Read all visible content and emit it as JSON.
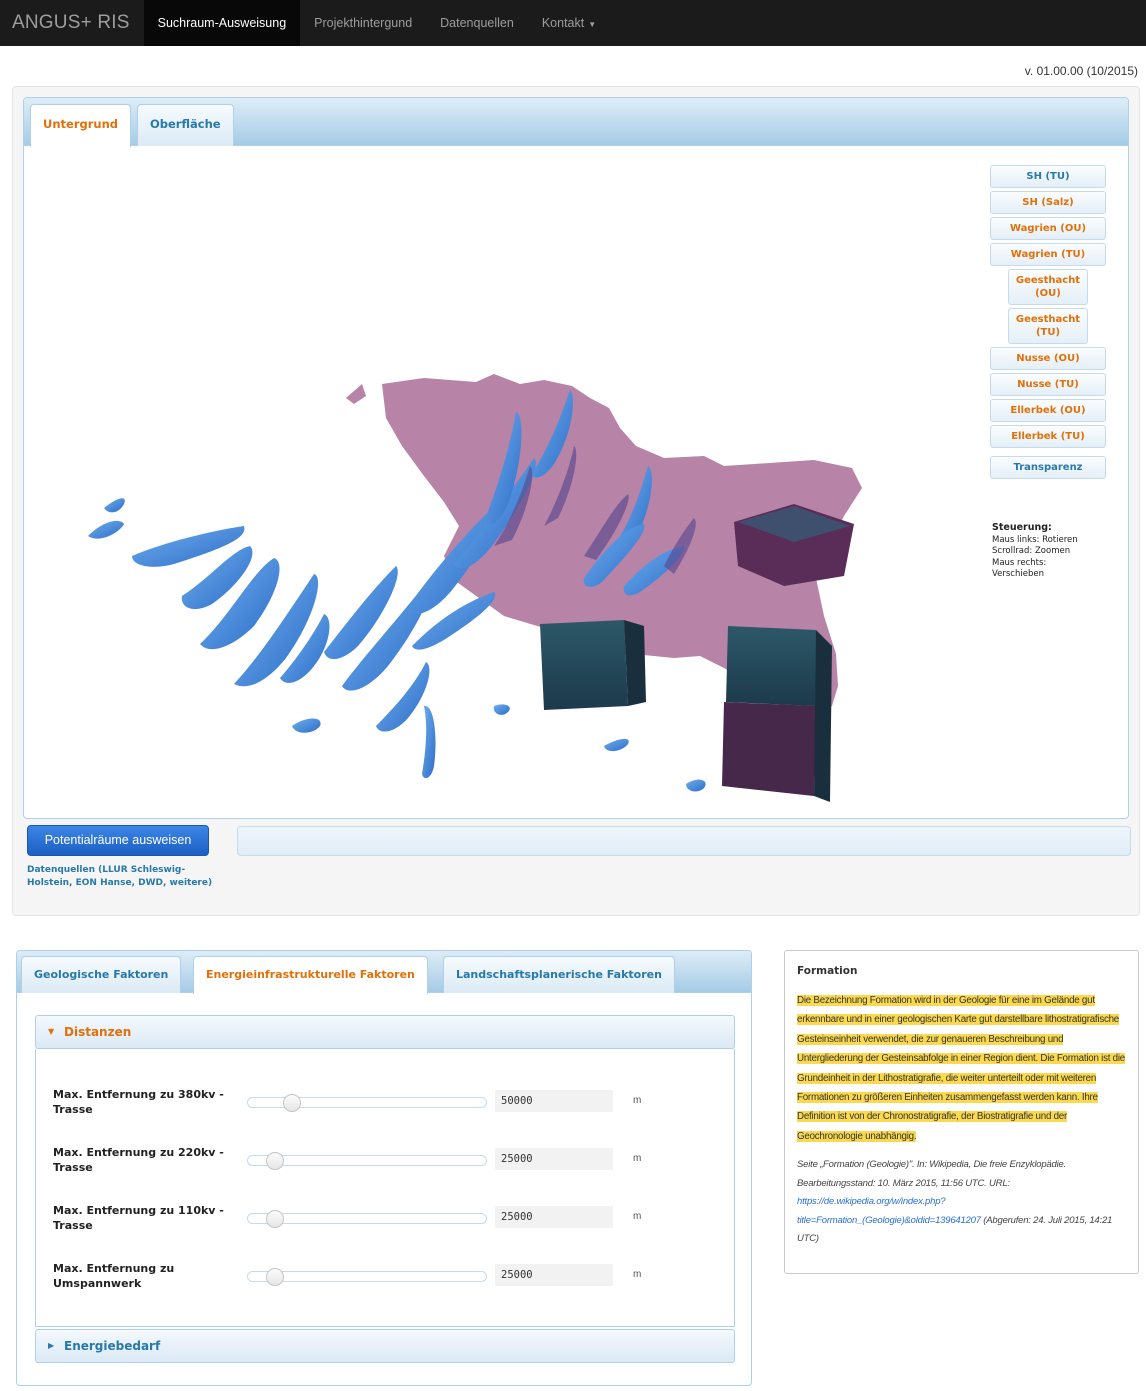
{
  "nav": {
    "brand": "ANGUS+ RIS",
    "items": [
      {
        "label": "Suchraum-Ausweisung",
        "active": true
      },
      {
        "label": "Projekthintergund",
        "active": false
      },
      {
        "label": "Datenquellen",
        "active": false
      },
      {
        "label": "Kontakt",
        "active": false,
        "dropdown": true
      }
    ]
  },
  "version": "v. 01.00.00 (10/2015)",
  "viewer": {
    "tabs": [
      {
        "label": "Untergrund",
        "active": true
      },
      {
        "label": "Oberfläche",
        "active": false
      }
    ],
    "layers": [
      {
        "label": "SH (TU)",
        "color": "blue"
      },
      {
        "label": "SH (Salz)",
        "color": "orange"
      },
      {
        "label": "Wagrien (OU)",
        "color": "orange"
      },
      {
        "label": "Wagrien (TU)",
        "color": "orange"
      },
      {
        "label": "Geesthacht (OU)",
        "color": "orange"
      },
      {
        "label": "Geesthacht (TU)",
        "color": "orange"
      },
      {
        "label": "Nusse (OU)",
        "color": "orange"
      },
      {
        "label": "Nusse (TU)",
        "color": "orange"
      },
      {
        "label": "Ellerbek (OU)",
        "color": "orange"
      },
      {
        "label": "Ellerbek (TU)",
        "color": "orange"
      }
    ],
    "transparency_label": "Transparenz",
    "controls": {
      "title": "Steuerung:",
      "line1": "Maus links: Rotieren",
      "line2": "Scrollrad: Zoomen",
      "line3": "Maus rechts:",
      "line4": "Verschieben"
    },
    "action_button": "Potentialräume ausweisen",
    "sources_link": "Datenquellen (LLUR Schleswig-Holstein, EON Hanse, DWD, weitere)",
    "colors": {
      "terrain": "#b783a6",
      "salt": "#3d7fd4",
      "blocks": "#234a5c"
    }
  },
  "factors": {
    "tabs": [
      {
        "label": "Geologische Faktoren",
        "active": false
      },
      {
        "label": "Energieinfrastrukturelle Faktoren",
        "active": true
      },
      {
        "label": "Landschaftsplanerische Faktoren",
        "active": false
      }
    ],
    "accordion_open": "Distanzen",
    "accordion_closed": "Energiebedarf",
    "rows": [
      {
        "label": "Max. Entfernung zu 380kv - Trasse",
        "value": "50000",
        "unit": "m",
        "fraction": 0.16
      },
      {
        "label": "Max. Entfernung zu 220kv - Trasse",
        "value": "25000",
        "unit": "m",
        "fraction": 0.08
      },
      {
        "label": "Max. Entfernung zu 110kv - Trasse",
        "value": "25000",
        "unit": "m",
        "fraction": 0.08
      },
      {
        "label": "Max. Entfernung zu Umspannwerk",
        "value": "25000",
        "unit": "m",
        "fraction": 0.08
      }
    ]
  },
  "info": {
    "title": "Formation",
    "text": "Die Bezeichnung Formation wird in der Geologie für eine im Gelände gut erkennbare und in einer geologischen Karte gut darstellbare lithostratigrafische Gesteinseinheit verwendet, die zur genaueren Beschreibung und Untergliederung der Gesteinsabfolge in einer Region dient. Die Formation ist die Grundeinheit in der Lithostratigrafie, die weiter unterteilt oder mit weiteren Formationen zu größeren Einheiten zusammengefasst werden kann. Ihre Definition ist von der Chronostratigrafie, der Biostratigrafie und der Geochronologie unabhängig.",
    "citation_prefix": "Seite „Formation (Geologie)\". In: Wikipedia, Die freie Enzyklopädie. Bearbeitungsstand: 10. März 2015, 11:56 UTC. URL:",
    "citation_url": "https://de.wikipedia.org/w/index.php?title=Formation_(Geologie)&oldid=139641207",
    "citation_suffix": "(Abgerufen: 24. Juli 2015, 14:21 UTC)"
  }
}
